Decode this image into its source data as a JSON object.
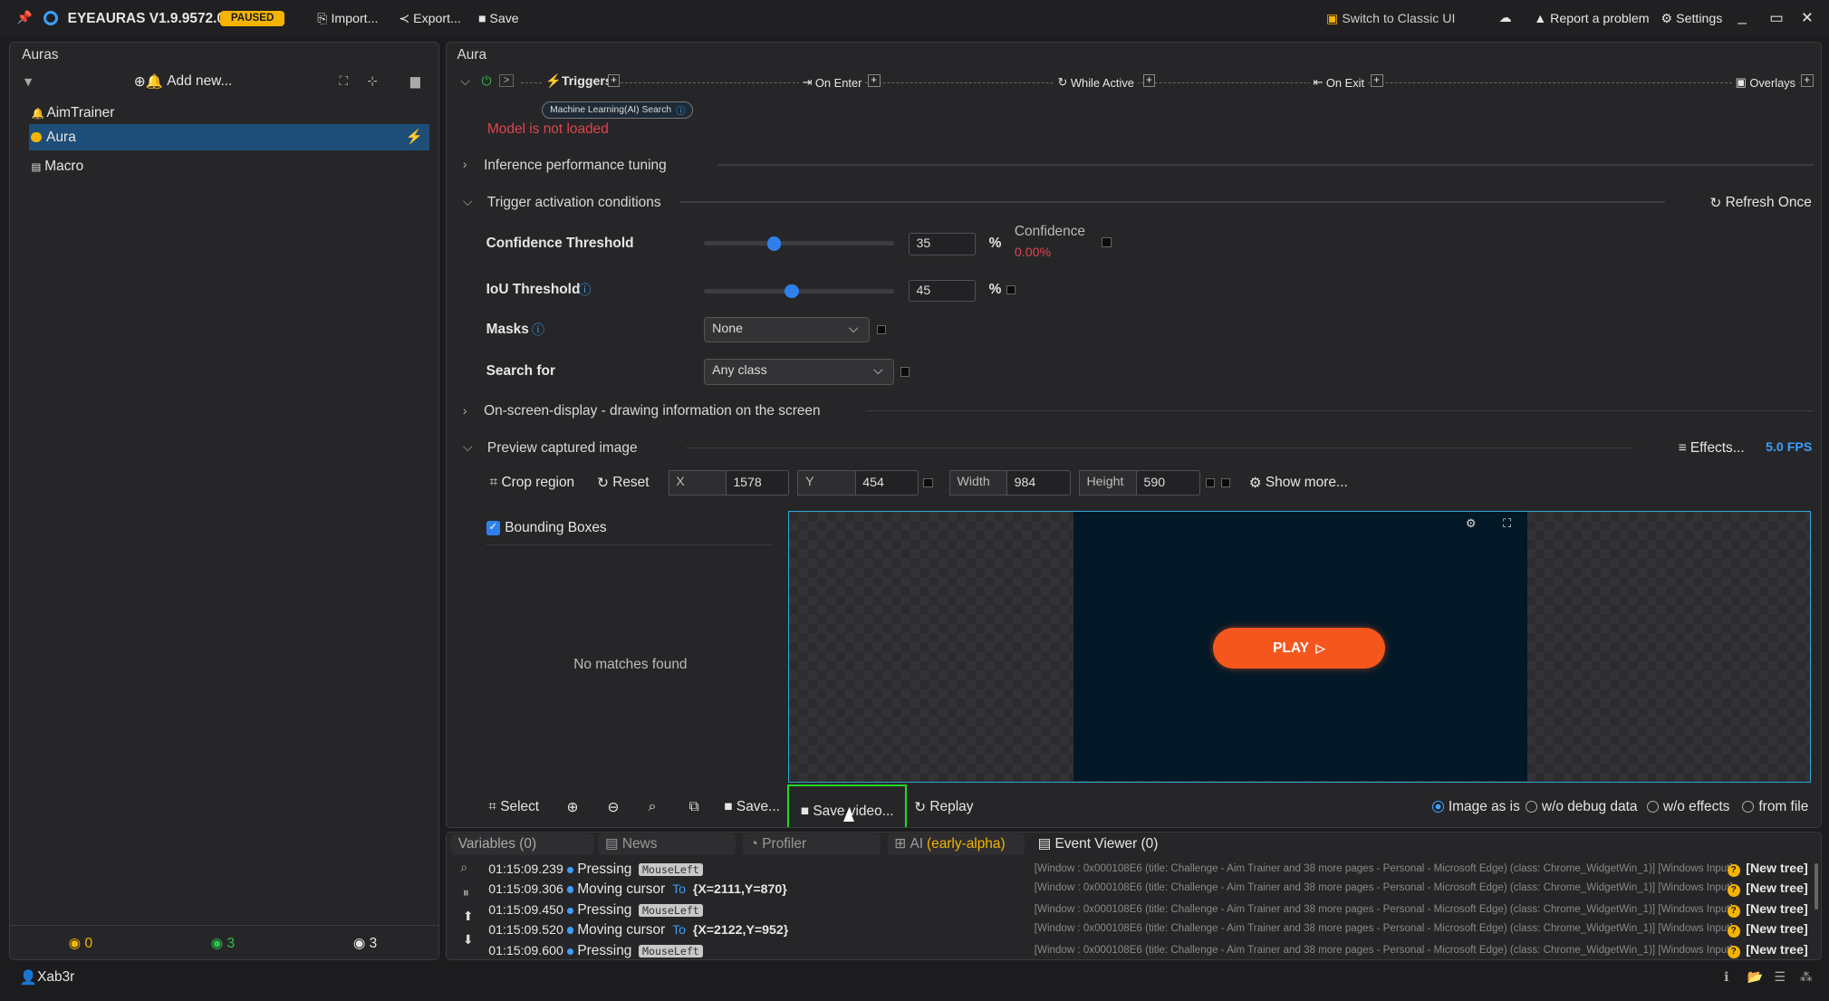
{
  "titlebar": {
    "app_title": "EYEAURAS V1.9.9572.0",
    "status": "PAUSED",
    "import": "Import...",
    "export": "Export...",
    "save": "Save",
    "classic": "Switch to Classic UI",
    "report": "Report a problem",
    "settings": "Settings"
  },
  "left": {
    "title": "Auras",
    "add_new": "Add new...",
    "items": [
      "AimTrainer",
      "Aura",
      "Macro"
    ],
    "stats": [
      "0",
      "3",
      "3"
    ],
    "user": "Xab3r"
  },
  "aura": {
    "title": "Aura",
    "pipeline": {
      "triggers": "Triggers",
      "on_enter": "On Enter",
      "while_active": "While Active",
      "on_exit": "On Exit",
      "overlays": "Overlays",
      "trigger_chip": "Machine Learning(AI) Search"
    },
    "error": "Model is not loaded",
    "sections": {
      "inference": "Inference performance tuning",
      "activation": "Trigger activation conditions",
      "osd": "On-screen-display - drawing information on the screen",
      "preview": "Preview captured image"
    },
    "refresh": "Refresh Once",
    "confidence": {
      "label": "Confidence Threshold",
      "value": "35",
      "unit": "%",
      "fraction": 0.35,
      "side_label": "Confidence",
      "side_value": "0.00%"
    },
    "iou": {
      "label": "IoU Threshold",
      "value": "45",
      "unit": "%",
      "fraction": 0.45
    },
    "masks": {
      "label": "Masks",
      "value": "None"
    },
    "search": {
      "label": "Search for",
      "value": "Any class"
    },
    "effects": "Effects...",
    "fps": "5.0 FPS",
    "crop": {
      "crop_label": "Crop region",
      "reset": "Reset",
      "x_label": "X",
      "x": "1578",
      "y_label": "Y",
      "y": "454",
      "w_label": "Width",
      "w": "984",
      "h_label": "Height",
      "h": "590",
      "show_more": "Show more..."
    },
    "bounding_boxes": "Bounding Boxes",
    "no_matches": "No matches found",
    "play": "PLAY",
    "toolbar": {
      "select": "Select",
      "save": "Save...",
      "save_video": "Save video...",
      "replay": "Replay"
    },
    "radios": [
      "Image as is",
      "w/o debug data",
      "w/o effects",
      "from file"
    ]
  },
  "bottom": {
    "tabs": [
      "Variables (0)",
      "News",
      "Profiler",
      "AI",
      "Event Viewer (0)"
    ],
    "ai_badge": "(early-alpha)",
    "logs": [
      {
        "time": "01:15:09.239",
        "action": "Pressing",
        "tag": "MouseLeft",
        "to": "",
        "coords": ""
      },
      {
        "time": "01:15:09.306",
        "action": "Moving cursor",
        "tag": "",
        "to": "To",
        "coords": "{X=2111,Y=870}"
      },
      {
        "time": "01:15:09.450",
        "action": "Pressing",
        "tag": "MouseLeft",
        "to": "",
        "coords": ""
      },
      {
        "time": "01:15:09.520",
        "action": "Moving cursor",
        "tag": "",
        "to": "To",
        "coords": "{X=2122,Y=952}"
      },
      {
        "time": "01:15:09.600",
        "action": "Pressing",
        "tag": "MouseLeft",
        "to": "",
        "coords": ""
      }
    ],
    "log_source": "[Window : 0x000108E6 (title: Challenge - Aim Trainer and 38 more pages - Personal - Microsoft Edge) (class: Chrome_WidgetWin_1)] [Windows Input]",
    "new_tree": "[New tree]"
  },
  "colors": {
    "accent": "#2f80ed",
    "paused": "#f5b400",
    "error": "#e0454f",
    "highlight": "#22d822",
    "play": "#f5561e"
  }
}
